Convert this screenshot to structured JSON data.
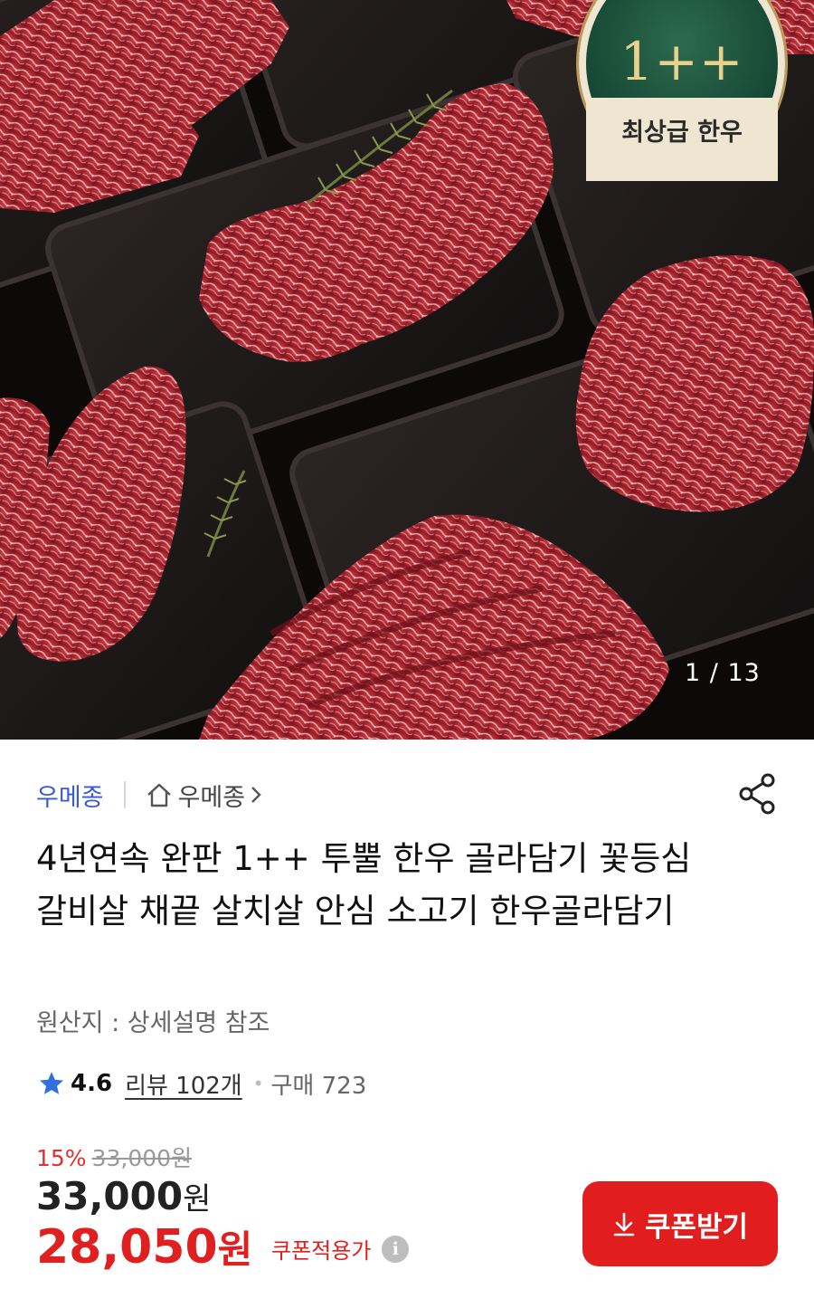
{
  "hero": {
    "grade_badge": "1++",
    "grade_badge_sub": "최상급 한우",
    "page_counter": "1 / 13"
  },
  "seller": {
    "name": "우메종",
    "store_name": "우메종"
  },
  "product": {
    "title": "4년연속 완판 1++ 투뿔 한우 골라담기 꽃등심 갈비살 채끝 살치살 안심 소고기 한우골라담기",
    "origin": "원산지 : 상세설명 참조",
    "rating": "4.6",
    "review": "리뷰 102개",
    "purchase": "구매 723"
  },
  "price": {
    "discount_rate": "15%",
    "original": "33,000",
    "original_unit": "원",
    "sale": "33,000",
    "sale_unit": "원",
    "coupon_price": "28,050",
    "coupon_unit": "원",
    "coupon_label": "쿠폰적용가"
  },
  "buttons": {
    "coupon": "쿠폰받기"
  },
  "icons": {
    "share": "share-icon",
    "home": "home-icon",
    "star": "star-icon",
    "info": "info-icon",
    "download": "download-icon"
  },
  "colors": {
    "accent_red": "#e21d1d",
    "seller_blue": "#3a5bd0",
    "star_blue": "#2f6fe0"
  }
}
